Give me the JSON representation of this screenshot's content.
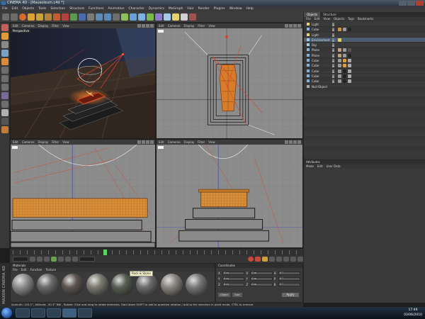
{
  "window": {
    "title": "CINEMA 4D - [Mausoleum.c4d *]"
  },
  "menubar": [
    "File",
    "Edit",
    "Objects",
    "Tools",
    "Selection",
    "Structure",
    "Functions",
    "Animation",
    "Character",
    "Dynamics",
    "MoGraph",
    "Hair",
    "Render",
    "Plugins",
    "Window",
    "Help"
  ],
  "viewport_menu": [
    "Edit",
    "Cameras",
    "Display",
    "Filter",
    "View"
  ],
  "viewports": {
    "perspective_label": "Perspective"
  },
  "object_manager": {
    "tabs": [
      "Objects",
      "Structure"
    ],
    "menu": [
      "File",
      "Edit",
      "View",
      "Objects",
      "Tags",
      "Bookmarks"
    ],
    "objects": [
      "Light",
      "Cube",
      "Light",
      "Environment",
      "Sky",
      "Plane",
      "Plane",
      "Cube",
      "Cube",
      "Cube",
      "Cube",
      "Cube",
      "Null Object"
    ]
  },
  "attributes": {
    "title": "Attributes",
    "menu": [
      "Mode",
      "Edit",
      "User Data"
    ]
  },
  "materials": {
    "title": "Materials",
    "menu": [
      "File",
      "Edit",
      "Function",
      "Texture"
    ],
    "tooltip": "Rock & Stone",
    "swatches": [
      {
        "color": "#8d8d8d"
      },
      {
        "color": "#6a6a6a"
      },
      {
        "color": "#5c5450"
      },
      {
        "color": "#7a7a70"
      },
      {
        "color": "#585e52"
      },
      {
        "color": "#6b6b6b"
      },
      {
        "color": "#8a8580"
      },
      {
        "color": "#777777"
      }
    ]
  },
  "coordinates": {
    "title": "Coordinates",
    "rows": [
      {
        "axis": "X",
        "value_pos": "0 m",
        "value_size": "0 m",
        "value_rot": "0 °"
      },
      {
        "axis": "Y",
        "value_pos": "0 m",
        "value_size": "0 m",
        "value_rot": "0 °"
      },
      {
        "axis": "Z",
        "value_pos": "0 m",
        "value_size": "0 m",
        "value_rot": "0 °"
      }
    ],
    "mode_label": "Object",
    "size_label": "Size",
    "apply_label": "Apply"
  },
  "statusbar": {
    "text": "Azimuth: 120.1°, Altitude: -30.3° NW - Rotate: Click and drag to rotate elements. Hold down SHIFT to add to quantize rotation / add to the selection in point mode, CTRL to remove."
  },
  "brand": {
    "text": "MAXON CINEMA 4D"
  },
  "taskbar": {
    "time": "17:49",
    "date": "03/06/2010"
  },
  "colors": {
    "accent_red": "#e0402a",
    "timeline_marker": "#5fd35f",
    "object_icon": "#7fb3e0"
  }
}
